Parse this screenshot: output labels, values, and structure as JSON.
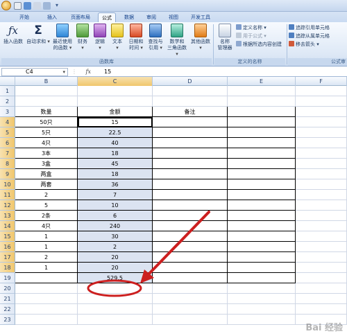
{
  "tabs": [
    "开始",
    "插入",
    "页面布局",
    "公式",
    "数据",
    "审阅",
    "视图",
    "开发工具"
  ],
  "active_tab": "公式",
  "ribbon": {
    "function_library": {
      "label": "函数库",
      "buttons": [
        {
          "line1": "插入函数",
          "line2": ""
        },
        {
          "line1": "自动求和",
          "line2": ""
        },
        {
          "line1": "最近使用",
          "line2": "的函数"
        },
        {
          "line1": "财务",
          "line2": ""
        },
        {
          "line1": "逻辑",
          "line2": ""
        },
        {
          "line1": "文本",
          "line2": ""
        },
        {
          "line1": "日期和",
          "line2": "时间"
        },
        {
          "line1": "查找与",
          "line2": "引用"
        },
        {
          "line1": "数学和",
          "line2": "三角函数"
        },
        {
          "line1": "其他函数",
          "line2": ""
        }
      ]
    },
    "defined_names": {
      "label": "定义的名称",
      "manager_line1": "名称",
      "manager_line2": "管理器",
      "items": [
        "定义名称",
        "用于公式",
        "根据所选内容创建"
      ]
    },
    "formula_auditing": {
      "label": "公式审",
      "items": [
        "追踪引用单元格",
        "追踪从属单元格",
        "移去箭头"
      ]
    }
  },
  "formula_bar": {
    "name_box": "C4",
    "fx_label": "fx",
    "value": "15"
  },
  "columns": [
    "B",
    "C",
    "D",
    "E",
    "F"
  ],
  "rows": [
    "1",
    "2",
    "3",
    "4",
    "5",
    "6",
    "7",
    "8",
    "9",
    "10",
    "11",
    "12",
    "13",
    "14",
    "15",
    "16",
    "17",
    "18",
    "19",
    "20",
    "21",
    "22",
    "23"
  ],
  "table": {
    "headers": [
      "数量",
      "金额",
      "备注"
    ],
    "quantities": [
      "50只",
      "5只",
      "4只",
      "3本",
      "3盒",
      "两盒",
      "两套",
      "2",
      "5",
      "2条",
      "4只",
      "1",
      "1",
      "2",
      "1"
    ],
    "amounts": [
      "15",
      "22.5",
      "40",
      "18",
      "45",
      "18",
      "36",
      "7",
      "10",
      "6",
      "240",
      "30",
      "2",
      "20",
      "20"
    ],
    "total": "529.5"
  },
  "watermark": "Bai 经验",
  "colors": {
    "annotation": "#cc1f1f",
    "selection": "#dbe3f1",
    "header_selected": "#f0c66c"
  }
}
